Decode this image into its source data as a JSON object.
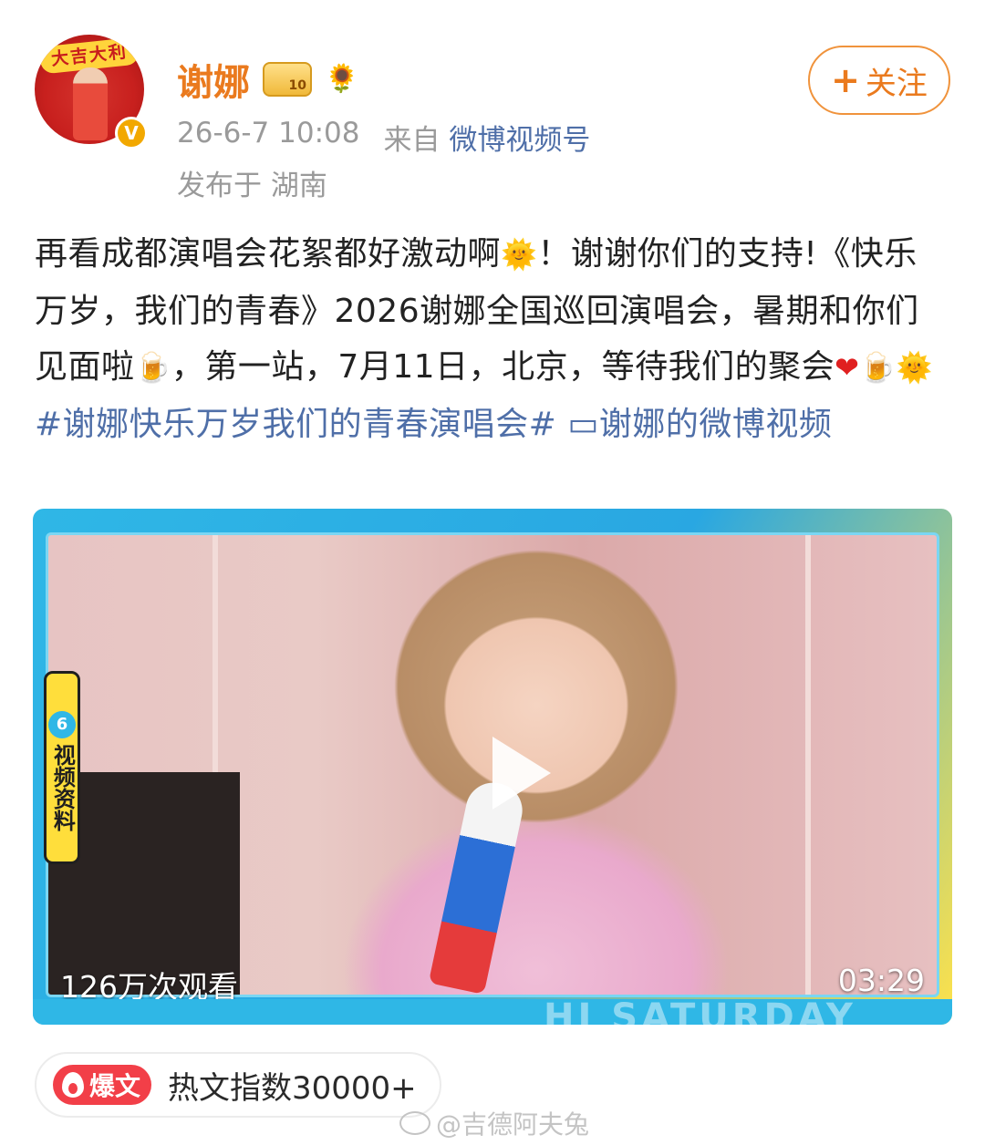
{
  "user": {
    "name": "谢娜",
    "avatar_banner": "大吉大利",
    "verified_badge": "V",
    "flower_emoji": "🌻"
  },
  "meta": {
    "timestamp": "26-6-7 10:08",
    "from_label": "来自",
    "source": "微博视频号",
    "location": "发布于 湖南"
  },
  "follow_button": {
    "plus": "+",
    "label": "关注"
  },
  "post": {
    "text_1": "再看成都演唱会花絮都好激动啊",
    "emoji_smile_1": "🌞",
    "text_2": "！谢谢你们的支持!《快乐万岁，我们的青春》2026谢娜全国巡回演唱会，暑期和你们见面啦",
    "emoji_beer_1": "🍺",
    "text_3": "，第一站，7月11日，北京，等待我们的聚会",
    "emoji_heart": "❤",
    "emoji_beer_2": "🍺",
    "emoji_smile_2": "🌞",
    "hashtag": "#谢娜快乐万岁我们的青春演唱会#",
    "video_link_icon": "▭",
    "video_link": "谢娜的微博视频"
  },
  "video": {
    "side_tag_number": "6",
    "side_tag_text": "视频资料",
    "views": "126万次观看",
    "duration": "03:29",
    "bottom_text": "HI SATURDAY"
  },
  "hot": {
    "tag": "爆文",
    "index_text": "热文指数30000+"
  },
  "watermark": "@吉德阿夫兔",
  "colors": {
    "name": "#ea7a1e",
    "link": "#4f6fa8",
    "hot_tag": "#f23f48",
    "video_frame": "#2fb7e6"
  }
}
